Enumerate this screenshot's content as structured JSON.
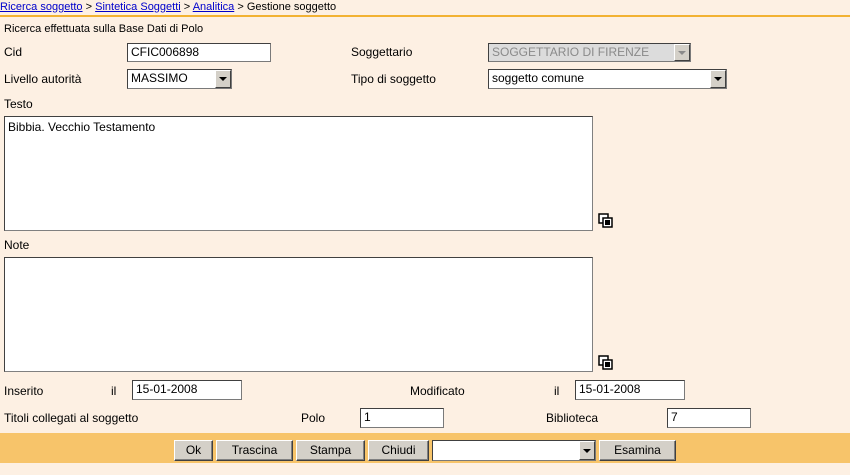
{
  "breadcrumb": {
    "links": [
      "Ricerca soggetto",
      "Sintetica Soggetti",
      "Analitica"
    ],
    "separator": ">",
    "current": "Gestione soggetto"
  },
  "info": "Ricerca effettuata sulla Base Dati di Polo",
  "form": {
    "cid_label": "Cid",
    "cid_value": "CFIC006898",
    "soggettario_label": "Soggettario",
    "soggettario_value": "SOGGETTARIO DI FIRENZE",
    "livello_label": "Livello autorità",
    "livello_value": "MASSIMO",
    "tipo_label": "Tipo di soggetto",
    "tipo_value": "soggetto comune",
    "testo_label": "Testo",
    "testo_value": "Bibbia. Vecchio Testamento",
    "note_label": "Note",
    "note_value": "",
    "inserito_label": "Inserito",
    "il_label": "il",
    "inserito_value": "15-01-2008",
    "modificato_label": "Modificato",
    "modificato_value": "15-01-2008",
    "titoli_label": "Titoli collegati al soggetto",
    "polo_label": "Polo",
    "polo_value": "1",
    "biblioteca_label": "Biblioteca",
    "biblioteca_value": "7"
  },
  "buttons": {
    "ok": "Ok",
    "trascina": "Trascina",
    "stampa": "Stampa",
    "chiudi": "Chiudi",
    "action_select": "",
    "esamina": "Esamina"
  },
  "colors": {
    "background": "#fdf0e3",
    "footer": "#f7c46a",
    "divider": "#f2b233",
    "link": "#0000cc"
  }
}
